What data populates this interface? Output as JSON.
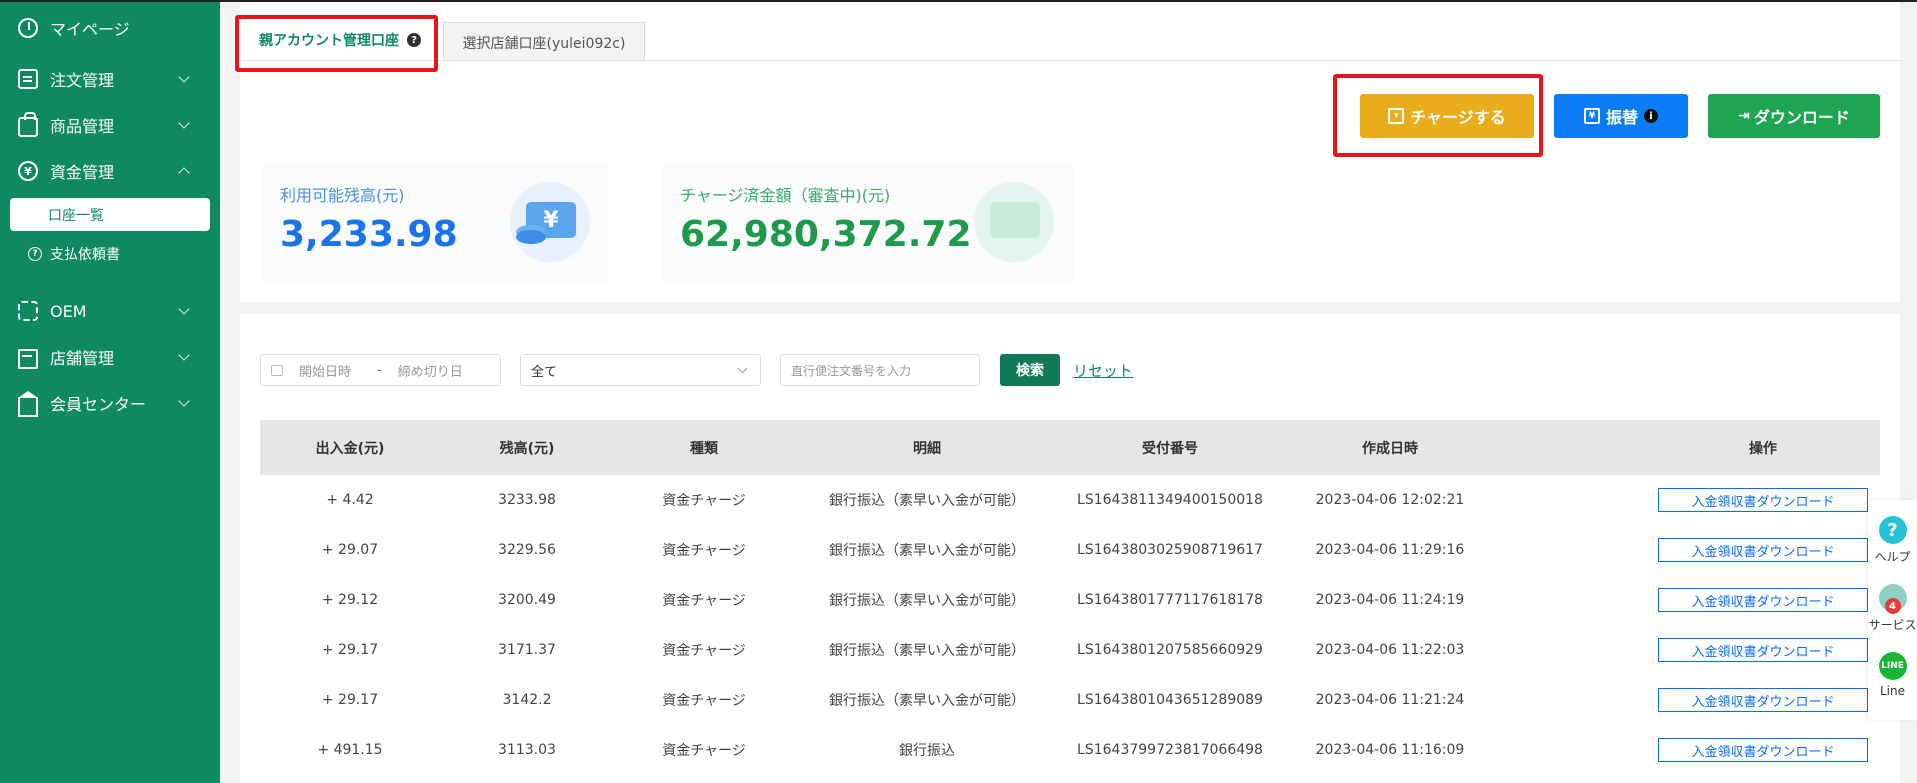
{
  "sidebar": {
    "items": [
      {
        "label": "マイページ",
        "icon": "dashboard-icon"
      },
      {
        "label": "注文管理",
        "icon": "order-icon"
      },
      {
        "label": "商品管理",
        "icon": "product-icon"
      },
      {
        "label": "資金管理",
        "icon": "yen-icon"
      },
      {
        "label": "OEM",
        "icon": "oem-icon"
      },
      {
        "label": "店舗管理",
        "icon": "store-icon"
      },
      {
        "label": "会員センター",
        "icon": "crown-icon"
      }
    ],
    "sub_items": [
      {
        "label": "口座一覧"
      },
      {
        "label": "支払依頼書"
      }
    ]
  },
  "tabs": [
    {
      "label": "親アカウント管理口座",
      "help": "?"
    },
    {
      "label": "選択店舗口座(yulei092c)"
    }
  ],
  "actions": {
    "charge": "チャージする",
    "transfer": "振替",
    "transfer_info": "i",
    "download": "ダウンロード"
  },
  "stats": [
    {
      "label": "利用可能残高(元)",
      "value": "3,233.98",
      "color": "#1a73e8"
    },
    {
      "label": "チャージ済金額（審査中)(元)",
      "value": "62,980,372.72",
      "color": "#1f9a4b"
    }
  ],
  "filters": {
    "start_placeholder": "開始日時",
    "separator": "-",
    "end_placeholder": "締め切り日",
    "select_value": "全て",
    "order_placeholder": "直行便注文番号を入力",
    "search": "検索",
    "reset": "リセット"
  },
  "table": {
    "headers": [
      "出入金(元)",
      "残高(元)",
      "種類",
      "明細",
      "受付番号",
      "作成日時",
      "操作"
    ],
    "rows": [
      {
        "amount": "+ 4.42",
        "balance": "3233.98",
        "type": "資金チャージ",
        "detail": "銀行振込（素早い入金が可能）",
        "receipt": "LS1643811349400150018",
        "created": "2023-04-06 12:02:21",
        "action": "入金領収書ダウンロード"
      },
      {
        "amount": "+ 29.07",
        "balance": "3229.56",
        "type": "資金チャージ",
        "detail": "銀行振込（素早い入金が可能）",
        "receipt": "LS1643803025908719617",
        "created": "2023-04-06 11:29:16",
        "action": "入金領収書ダウンロード"
      },
      {
        "amount": "+ 29.12",
        "balance": "3200.49",
        "type": "資金チャージ",
        "detail": "銀行振込（素早い入金が可能）",
        "receipt": "LS1643801777117618178",
        "created": "2023-04-06 11:24:19",
        "action": "入金領収書ダウンロード"
      },
      {
        "amount": "+ 29.17",
        "balance": "3171.37",
        "type": "資金チャージ",
        "detail": "銀行振込（素早い入金が可能）",
        "receipt": "LS1643801207585660929",
        "created": "2023-04-06 11:22:03",
        "action": "入金領収書ダウンロード"
      },
      {
        "amount": "+ 29.17",
        "balance": "3142.2",
        "type": "資金チャージ",
        "detail": "銀行振込（素早い入金が可能）",
        "receipt": "LS1643801043651289089",
        "created": "2023-04-06 11:21:24",
        "action": "入金領収書ダウンロード"
      },
      {
        "amount": "+ 491.15",
        "balance": "3113.03",
        "type": "資金チャージ",
        "detail": "銀行振込",
        "receipt": "LS1643799723817066498",
        "created": "2023-04-06 11:16:09",
        "action": "入金領収書ダウンロード"
      }
    ]
  },
  "float_panel": {
    "help": "ヘルプ",
    "service": "サービス",
    "service_badge": "4",
    "line": "Line",
    "line_icon_text": "LINE"
  },
  "colors": {
    "sidebar": "#0f8a5f",
    "charge": "#e9ac1a",
    "transfer": "#0a7cf5",
    "download": "#1fa552",
    "highlight": "#e8141b"
  }
}
